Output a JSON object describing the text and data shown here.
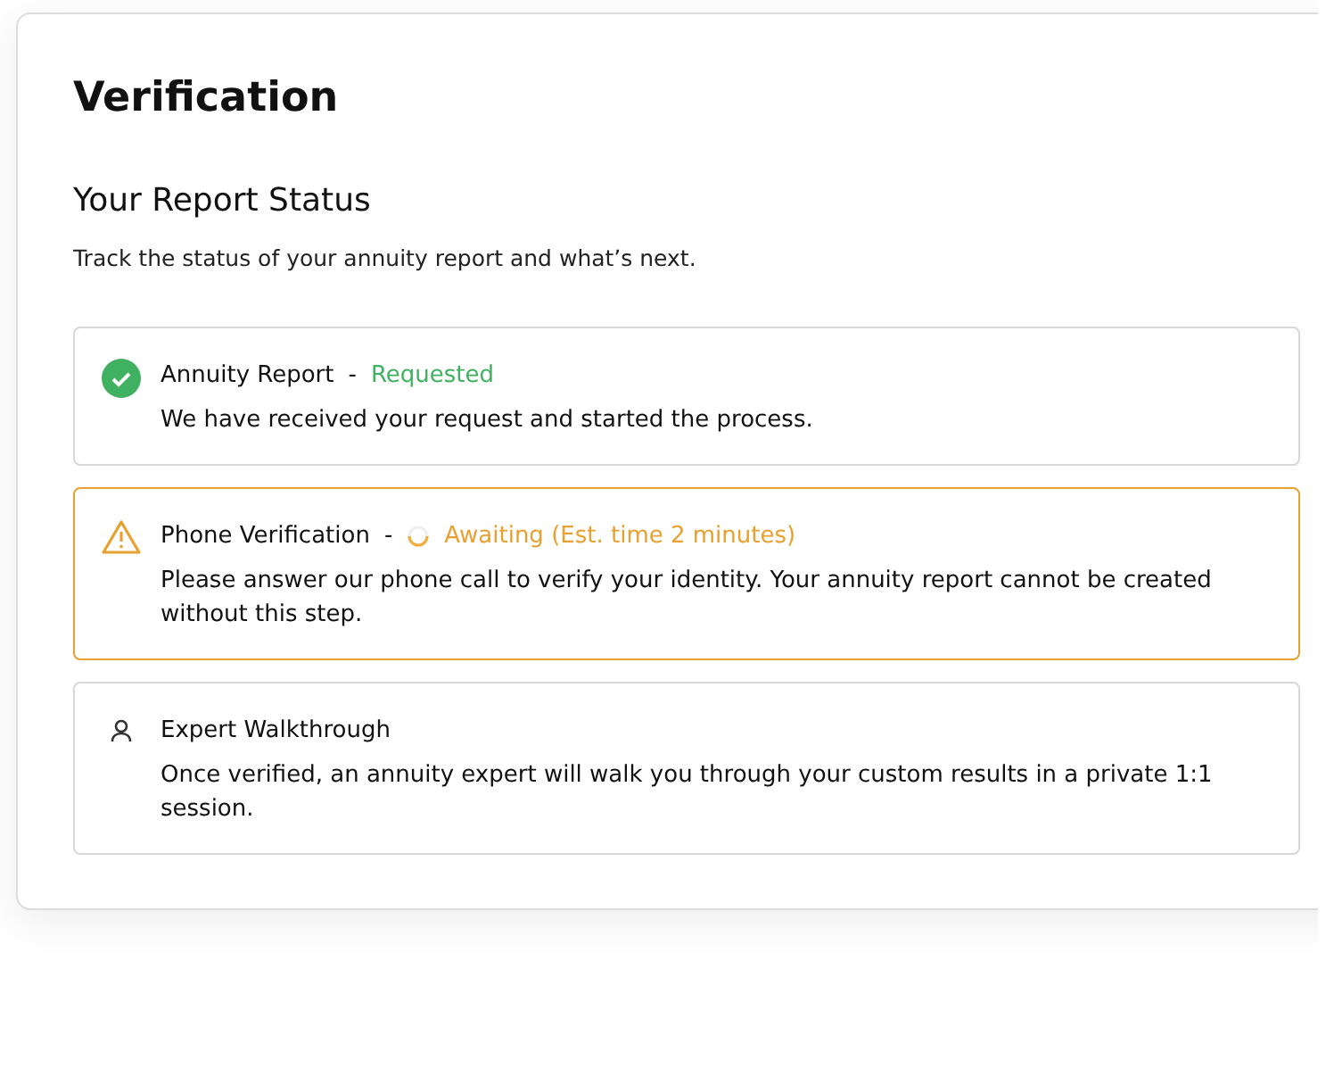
{
  "title": "Verification",
  "section": {
    "heading": "Your Report Status",
    "description": "Track the status of your annuity report and what’s next."
  },
  "steps": [
    {
      "kind": "done",
      "name": "Annuity Report",
      "separator": "-",
      "status": "Requested",
      "text": "We have received your request and started the process."
    },
    {
      "kind": "pending",
      "name": "Phone Verification",
      "separator": "-",
      "status": "Awaiting (Est. time 2 minutes)",
      "text": "Please answer our phone call to verify your identity. Your annuity report cannot be created without this step."
    },
    {
      "kind": "upcoming",
      "name": "Expert Walkthrough",
      "text": "Once verified, an annuity expert will walk you through your custom results in a private 1:1 session."
    }
  ]
}
